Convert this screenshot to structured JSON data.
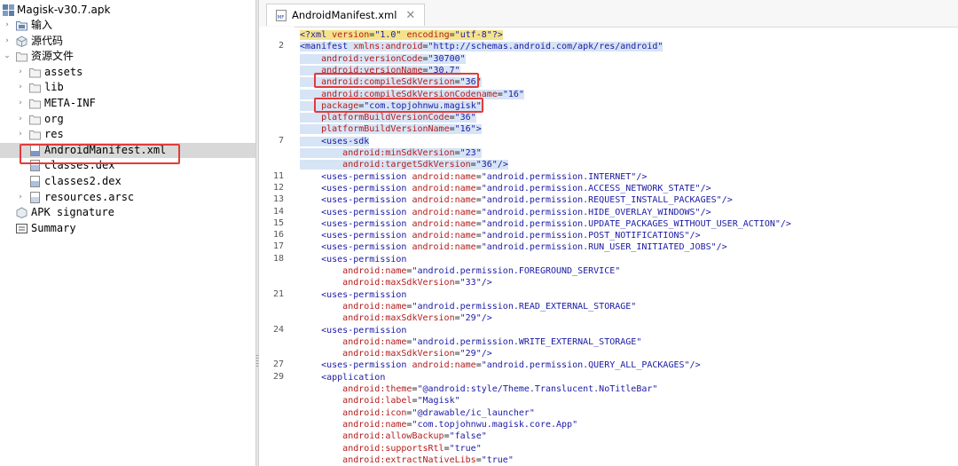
{
  "sidebar": {
    "root": "Magisk-v30.7.apk",
    "items": [
      {
        "label": "输入",
        "level": 0,
        "expand": "collapsed",
        "icon": "input-folder-icon"
      },
      {
        "label": "源代码",
        "level": 0,
        "expand": "collapsed",
        "icon": "source-code-icon"
      },
      {
        "label": "资源文件",
        "level": 0,
        "expand": "expanded",
        "icon": "folder-icon"
      },
      {
        "label": "assets",
        "level": 1,
        "expand": "collapsed",
        "icon": "folder-icon"
      },
      {
        "label": "lib",
        "level": 1,
        "expand": "collapsed",
        "icon": "folder-icon"
      },
      {
        "label": "META-INF",
        "level": 1,
        "expand": "collapsed",
        "icon": "folder-icon"
      },
      {
        "label": "org",
        "level": 1,
        "expand": "collapsed",
        "icon": "folder-icon"
      },
      {
        "label": "res",
        "level": 1,
        "expand": "collapsed",
        "icon": "folder-icon"
      },
      {
        "label": "AndroidManifest.xml",
        "level": 1,
        "expand": "none",
        "icon": "manifest-file-icon",
        "selected": true
      },
      {
        "label": "classes.dex",
        "level": 1,
        "expand": "none",
        "icon": "dex-file-icon"
      },
      {
        "label": "classes2.dex",
        "level": 1,
        "expand": "none",
        "icon": "dex-file-icon"
      },
      {
        "label": "resources.arsc",
        "level": 1,
        "expand": "collapsed",
        "icon": "arsc-file-icon"
      },
      {
        "label": "APK signature",
        "level": 0,
        "expand": "none",
        "icon": "signature-icon"
      },
      {
        "label": "Summary",
        "level": 0,
        "expand": "none",
        "icon": "summary-icon"
      }
    ]
  },
  "editor": {
    "tab": {
      "label": "AndroidManifest.xml",
      "close": "✕",
      "icon_text": "MF"
    },
    "lines": [
      {
        "n": "",
        "text": "<?xml version=\"1.0\" encoding=\"utf-8\"?>",
        "hl": "first"
      },
      {
        "n": "2",
        "text": "<manifest xmlns:android=\"http://schemas.android.com/apk/res/android\"",
        "hl": "sel"
      },
      {
        "n": "",
        "text": "    android:versionCode=\"30700\"",
        "hl": "sel"
      },
      {
        "n": "",
        "text": "    android:versionName=\"30.7\"",
        "hl": "sel"
      },
      {
        "n": "",
        "text": "    android:compileSdkVersion=\"36\"",
        "hl": "sel"
      },
      {
        "n": "",
        "text": "    android:compileSdkVersionCodename=\"16\"",
        "hl": "sel"
      },
      {
        "n": "",
        "text": "    package=\"com.topjohnwu.magisk\"",
        "hl": "sel"
      },
      {
        "n": "",
        "text": "    platformBuildVersionCode=\"36\"",
        "hl": "sel"
      },
      {
        "n": "",
        "text": "    platformBuildVersionName=\"16\">",
        "hl": "sel"
      },
      {
        "n": "7",
        "text": "    <uses-sdk",
        "hl": "sel"
      },
      {
        "n": "",
        "text": "        android:minSdkVersion=\"23\"",
        "hl": "sel"
      },
      {
        "n": "",
        "text": "        android:targetSdkVersion=\"36\"/>",
        "hl": "sel"
      },
      {
        "n": "11",
        "text": "    <uses-permission android:name=\"android.permission.INTERNET\"/>",
        "hl": ""
      },
      {
        "n": "12",
        "text": "    <uses-permission android:name=\"android.permission.ACCESS_NETWORK_STATE\"/>",
        "hl": ""
      },
      {
        "n": "13",
        "text": "    <uses-permission android:name=\"android.permission.REQUEST_INSTALL_PACKAGES\"/>",
        "hl": ""
      },
      {
        "n": "14",
        "text": "    <uses-permission android:name=\"android.permission.HIDE_OVERLAY_WINDOWS\"/>",
        "hl": ""
      },
      {
        "n": "15",
        "text": "    <uses-permission android:name=\"android.permission.UPDATE_PACKAGES_WITHOUT_USER_ACTION\"/>",
        "hl": ""
      },
      {
        "n": "16",
        "text": "    <uses-permission android:name=\"android.permission.POST_NOTIFICATIONS\"/>",
        "hl": ""
      },
      {
        "n": "17",
        "text": "    <uses-permission android:name=\"android.permission.RUN_USER_INITIATED_JOBS\"/>",
        "hl": ""
      },
      {
        "n": "18",
        "text": "    <uses-permission",
        "hl": ""
      },
      {
        "n": "",
        "text": "        android:name=\"android.permission.FOREGROUND_SERVICE\"",
        "hl": ""
      },
      {
        "n": "",
        "text": "        android:maxSdkVersion=\"33\"/>",
        "hl": ""
      },
      {
        "n": "21",
        "text": "    <uses-permission",
        "hl": ""
      },
      {
        "n": "",
        "text": "        android:name=\"android.permission.READ_EXTERNAL_STORAGE\"",
        "hl": ""
      },
      {
        "n": "",
        "text": "        android:maxSdkVersion=\"29\"/>",
        "hl": ""
      },
      {
        "n": "24",
        "text": "    <uses-permission",
        "hl": ""
      },
      {
        "n": "",
        "text": "        android:name=\"android.permission.WRITE_EXTERNAL_STORAGE\"",
        "hl": ""
      },
      {
        "n": "",
        "text": "        android:maxSdkVersion=\"29\"/>",
        "hl": ""
      },
      {
        "n": "27",
        "text": "    <uses-permission android:name=\"android.permission.QUERY_ALL_PACKAGES\"/>",
        "hl": ""
      },
      {
        "n": "29",
        "text": "    <application",
        "hl": ""
      },
      {
        "n": "",
        "text": "        android:theme=\"@android:style/Theme.Translucent.NoTitleBar\"",
        "hl": ""
      },
      {
        "n": "",
        "text": "        android:label=\"Magisk\"",
        "hl": ""
      },
      {
        "n": "",
        "text": "        android:icon=\"@drawable/ic_launcher\"",
        "hl": ""
      },
      {
        "n": "",
        "text": "        android:name=\"com.topjohnwu.magisk.core.App\"",
        "hl": ""
      },
      {
        "n": "",
        "text": "        android:allowBackup=\"false\"",
        "hl": ""
      },
      {
        "n": "",
        "text": "        android:supportsRtl=\"true\"",
        "hl": ""
      },
      {
        "n": "",
        "text": "        android:extractNativeLibs=\"true\"",
        "hl": ""
      }
    ]
  },
  "colors": {
    "highlight_box": "#e33b3b",
    "selection": "#d6e4f5",
    "tag": "#1a1aa6",
    "attr": "#b31b1b"
  }
}
